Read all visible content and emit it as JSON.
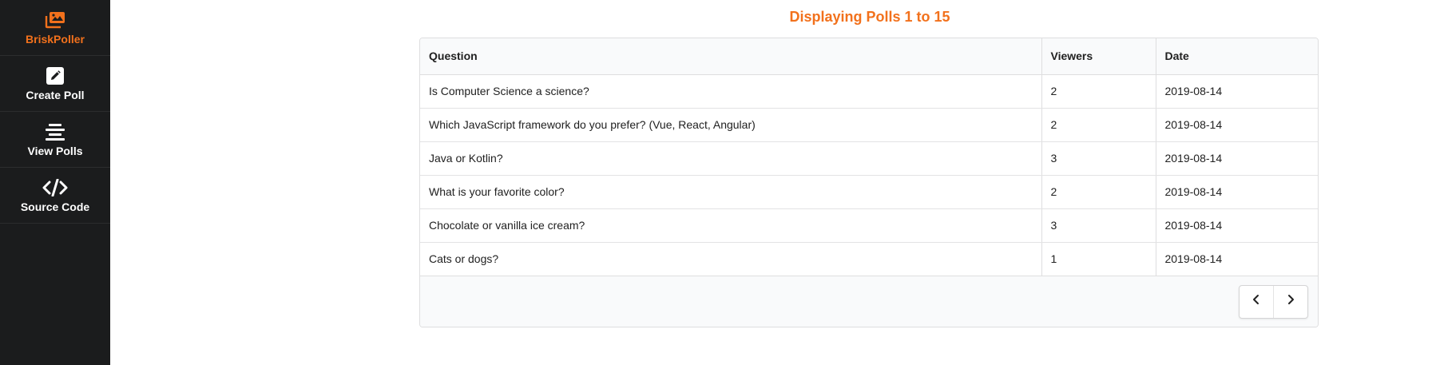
{
  "sidebar": {
    "brand": {
      "label": "BriskPoller",
      "icon": "images-icon",
      "color": "#f2711c"
    },
    "items": [
      {
        "label": "Create Poll",
        "icon": "edit-icon"
      },
      {
        "label": "View Polls",
        "icon": "align-center-icon"
      },
      {
        "label": "Source Code",
        "icon": "code-icon"
      }
    ]
  },
  "main": {
    "title": "Displaying Polls 1 to 15",
    "table": {
      "headers": [
        "Question",
        "Viewers",
        "Date"
      ],
      "rows": [
        [
          "Is Computer Science a science?",
          "2",
          "2019-08-14"
        ],
        [
          "Which JavaScript framework do you prefer? (Vue, React, Angular)",
          "2",
          "2019-08-14"
        ],
        [
          "Java or Kotlin?",
          "3",
          "2019-08-14"
        ],
        [
          "What is your favorite color?",
          "2",
          "2019-08-14"
        ],
        [
          "Chocolate or vanilla ice cream?",
          "3",
          "2019-08-14"
        ],
        [
          "Cats or dogs?",
          "1",
          "2019-08-14"
        ]
      ]
    },
    "pagination": {
      "prev_icon": "chevron-left-icon",
      "next_icon": "chevron-right-icon"
    }
  },
  "colors": {
    "accent": "#f2711c",
    "sidebar_bg": "#1b1c1d"
  }
}
